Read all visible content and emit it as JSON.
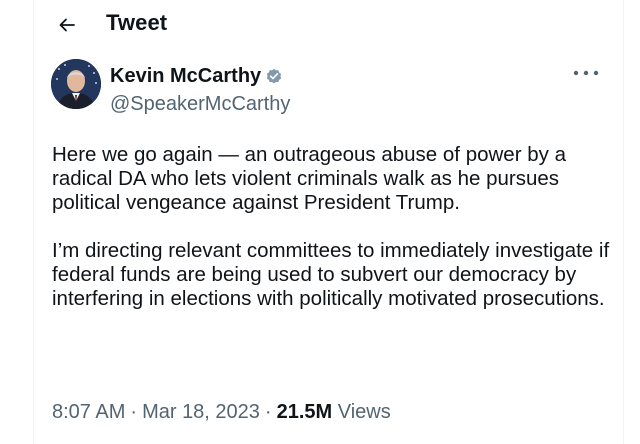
{
  "header": {
    "title": "Tweet",
    "back_icon": "arrow-left-icon"
  },
  "author": {
    "display_name": "Kevin McCarthy",
    "handle": "@SpeakerMcCarthy",
    "verified_badge_icon": "verified-badge-icon",
    "badge_color": "#829aab",
    "avatar_icon": "avatar-photo"
  },
  "more_icon": "more-options-icon",
  "tweet": {
    "paragraphs": [
      "Here we go again — an outrageous abuse of power by a radical DA who lets violent criminals walk as he pursues political vengeance against President Trump.",
      "I’m directing relevant committees to immediately investigate if federal funds are being used to subvert our democracy by interfering in elections with politically motivated prosecutions."
    ]
  },
  "meta": {
    "time": "8:07 AM",
    "separator": "·",
    "date": "Mar 18, 2023",
    "views_count": "21.5M",
    "views_label": "Views"
  },
  "colors": {
    "text_primary": "#0f1419",
    "text_secondary": "#536471",
    "divider": "#eff3f4"
  }
}
